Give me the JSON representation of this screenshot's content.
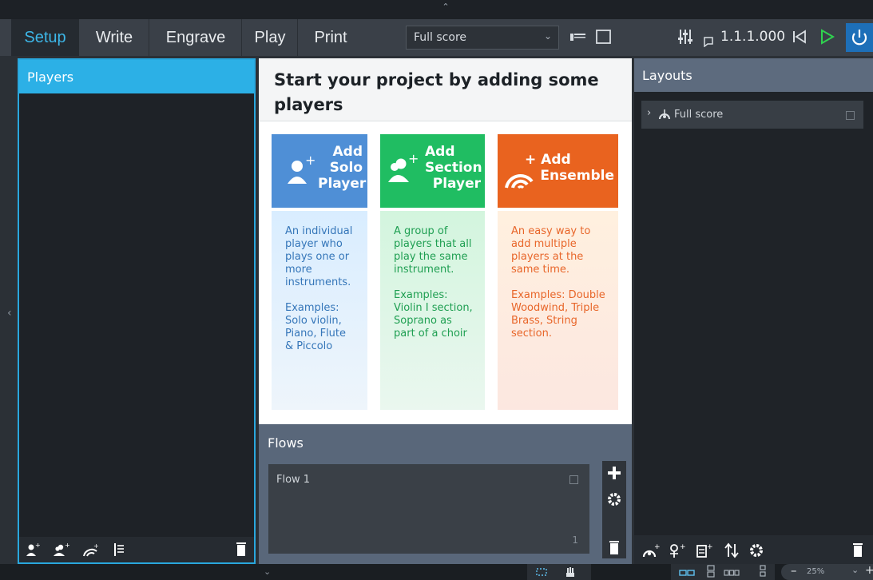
{
  "toolbar": {
    "tabs": [
      {
        "label": "Setup"
      },
      {
        "label": "Write"
      },
      {
        "label": "Engrave"
      },
      {
        "label": "Play"
      },
      {
        "label": "Print"
      }
    ],
    "layout_select": "Full score",
    "timecode": "1.1.1.000"
  },
  "players": {
    "title": "Players"
  },
  "start": {
    "title": "Start your project by adding some players",
    "cards": [
      {
        "label_lines": [
          "Add",
          "Solo",
          "Player"
        ],
        "description": "An individual player who plays one or more instruments.",
        "examples": "Examples: Solo violin, Piano, Flute & Piccolo",
        "color": "#4f8fd6"
      },
      {
        "label_lines": [
          "Add",
          "Section",
          "Player"
        ],
        "description": "A group of players that all play the same instrument.",
        "examples": "Examples: Violin I section, Soprano as part of a choir",
        "color": "#20bd62"
      },
      {
        "label_lines": [
          "+ Add",
          "Ensemble"
        ],
        "description": "An easy way to add multiple players at the same time.",
        "examples": "Examples: Double Woodwind, Triple Brass, String section.",
        "color": "#e9631f"
      }
    ]
  },
  "flows": {
    "title": "Flows",
    "items": [
      {
        "name": "Flow 1",
        "number": "1"
      }
    ]
  },
  "layouts": {
    "title": "Layouts",
    "items": [
      {
        "name": "Full score"
      }
    ]
  },
  "statusbar": {
    "zoom": "25%"
  },
  "colors": {
    "accent": "#2cb0e6",
    "solo": "#4f8fd6",
    "section": "#20bd62",
    "ensemble": "#e9631f",
    "play_green": "#2fd24f"
  }
}
